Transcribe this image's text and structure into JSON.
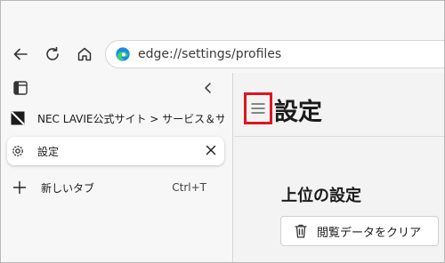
{
  "address_bar": {
    "url": "edge://settings/profiles"
  },
  "sidebar": {
    "tabs": [
      {
        "label": "NEC LAVIE公式サイト > サービス＆サポート"
      },
      {
        "label": "設定"
      }
    ],
    "new_tab": {
      "label": "新しいタブ",
      "shortcut": "Ctrl+T"
    }
  },
  "main": {
    "title": "設定",
    "section_title": "上位の設定",
    "clear_button_label": "閲覧データをクリア"
  },
  "colors": {
    "highlight_box": "#e0141e"
  },
  "icons": [
    "back-icon",
    "refresh-icon",
    "home-icon",
    "edge-logo-icon",
    "vertical-tabs-icon",
    "collapse-icon",
    "nec-favicon-icon",
    "gear-icon",
    "close-icon",
    "plus-icon",
    "hamburger-menu-icon",
    "trash-icon"
  ]
}
